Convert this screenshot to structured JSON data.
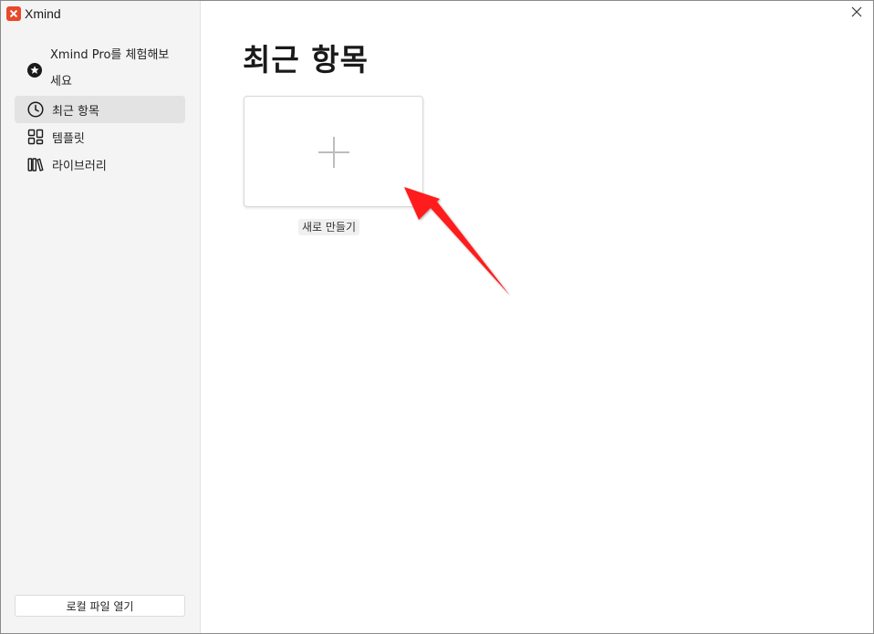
{
  "app": {
    "title": "Xmind",
    "logo_color": "#e8492a"
  },
  "sidebar": {
    "pro_promo": {
      "label": "Xmind Pro를 체험해보세요",
      "icon": "star-badge-icon"
    },
    "items": [
      {
        "id": "recent",
        "label": "최근 항목",
        "icon": "clock-icon",
        "active": true
      },
      {
        "id": "templates",
        "label": "템플릿",
        "icon": "grid-icon",
        "active": false
      },
      {
        "id": "library",
        "label": "라이브러리",
        "icon": "books-icon",
        "active": false
      }
    ],
    "open_local_label": "로컬 파일 열기"
  },
  "main": {
    "title": "최근 항목",
    "new_card": {
      "label": "새로 만들기",
      "icon": "plus-icon"
    }
  },
  "window": {
    "close_icon": "close-icon"
  },
  "annotation": {
    "arrow_color": "#ff0000"
  }
}
